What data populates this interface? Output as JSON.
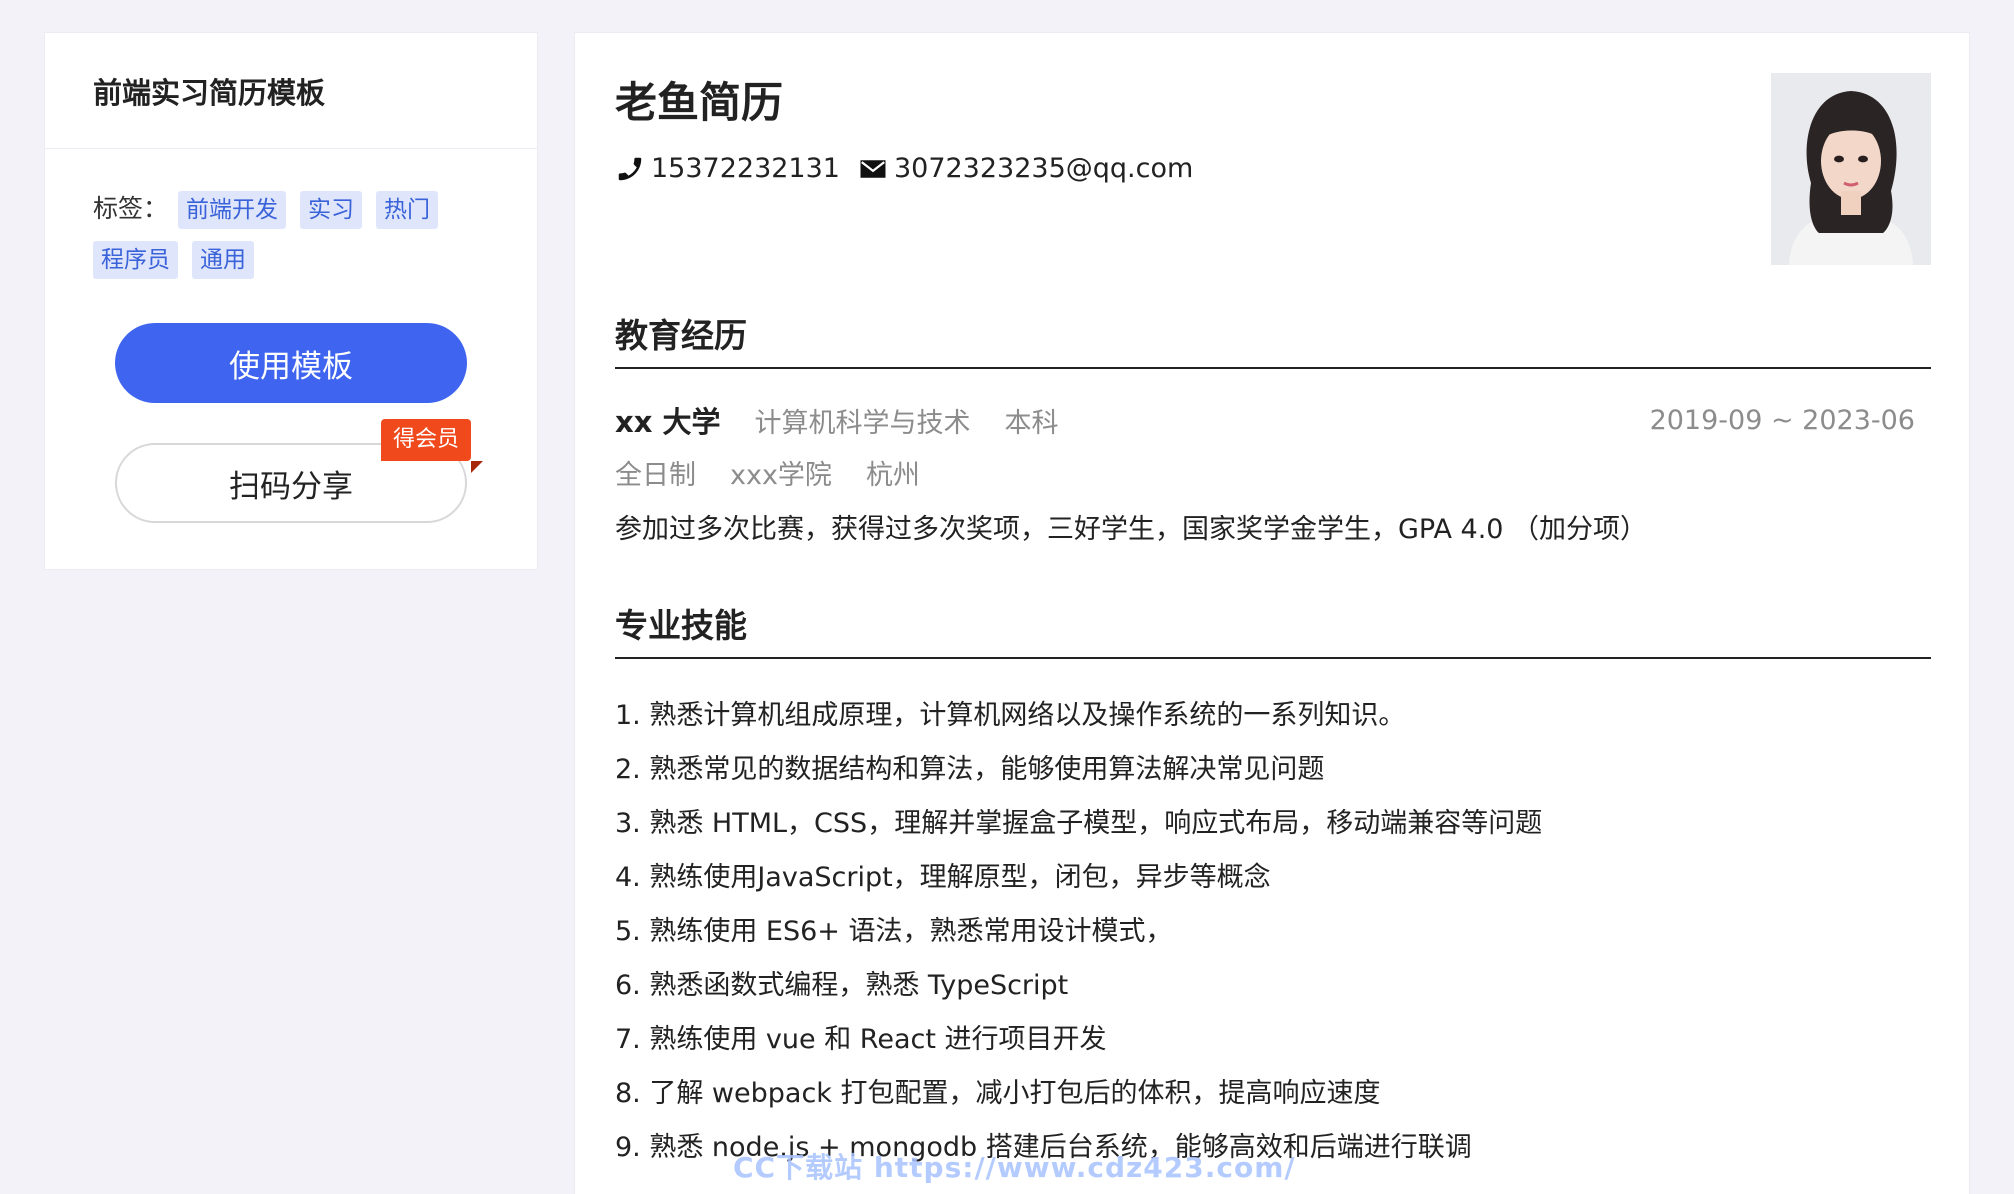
{
  "sidebar": {
    "title": "前端实习简历模板",
    "tags_label": "标签：",
    "tags": [
      "前端开发",
      "实习",
      "热门",
      "程序员",
      "通用"
    ],
    "use_button": "使用模板",
    "share_button": "扫码分享",
    "vip_badge": "得会员"
  },
  "resume": {
    "name": "老鱼简历",
    "phone": "15372232131",
    "email": "3072323235@qq.com",
    "education": {
      "title": "教育经历",
      "school": "xx 大学",
      "major": "计算机科学与技术",
      "degree": "本科",
      "dates": "2019-09 ~ 2023-06",
      "mode": "全日制",
      "college": "xxx学院",
      "city": "杭州",
      "note": "参加过多次比赛，获得过多次奖项，三好学生，国家奖学金学生，GPA 4.0 （加分项）"
    },
    "skills": {
      "title": "专业技能",
      "items": [
        "1. 熟悉计算机组成原理，计算机网络以及操作系统的一系列知识。",
        "2. 熟悉常见的数据结构和算法，能够使用算法解决常见问题",
        "3. 熟悉 HTML，CSS，理解并掌握盒子模型，响应式布局，移动端兼容等问题",
        "4. 熟练使用JavaScript，理解原型，闭包，异步等概念",
        "5. 熟练使用 ES6+ 语法，熟悉常用设计模式，",
        "6. 熟悉函数式编程，熟悉 TypeScript",
        "7. 熟练使用 vue 和 React 进行项目开发",
        "8. 了解 webpack 打包配置，减小打包后的体积，提高响应速度",
        "9. 熟悉 node.js + mongodb 搭建后台系统，能够高效和后端进行联调"
      ]
    }
  },
  "watermark": "CC下载站 https://www.cdz423.com/",
  "colors": {
    "primary": "#3f65f0",
    "tag_bg": "#dfe5fb",
    "tag_text": "#3a63d9",
    "vip": "#f04a1c"
  },
  "icons": {
    "phone": "phone-icon",
    "email": "envelope-icon"
  }
}
